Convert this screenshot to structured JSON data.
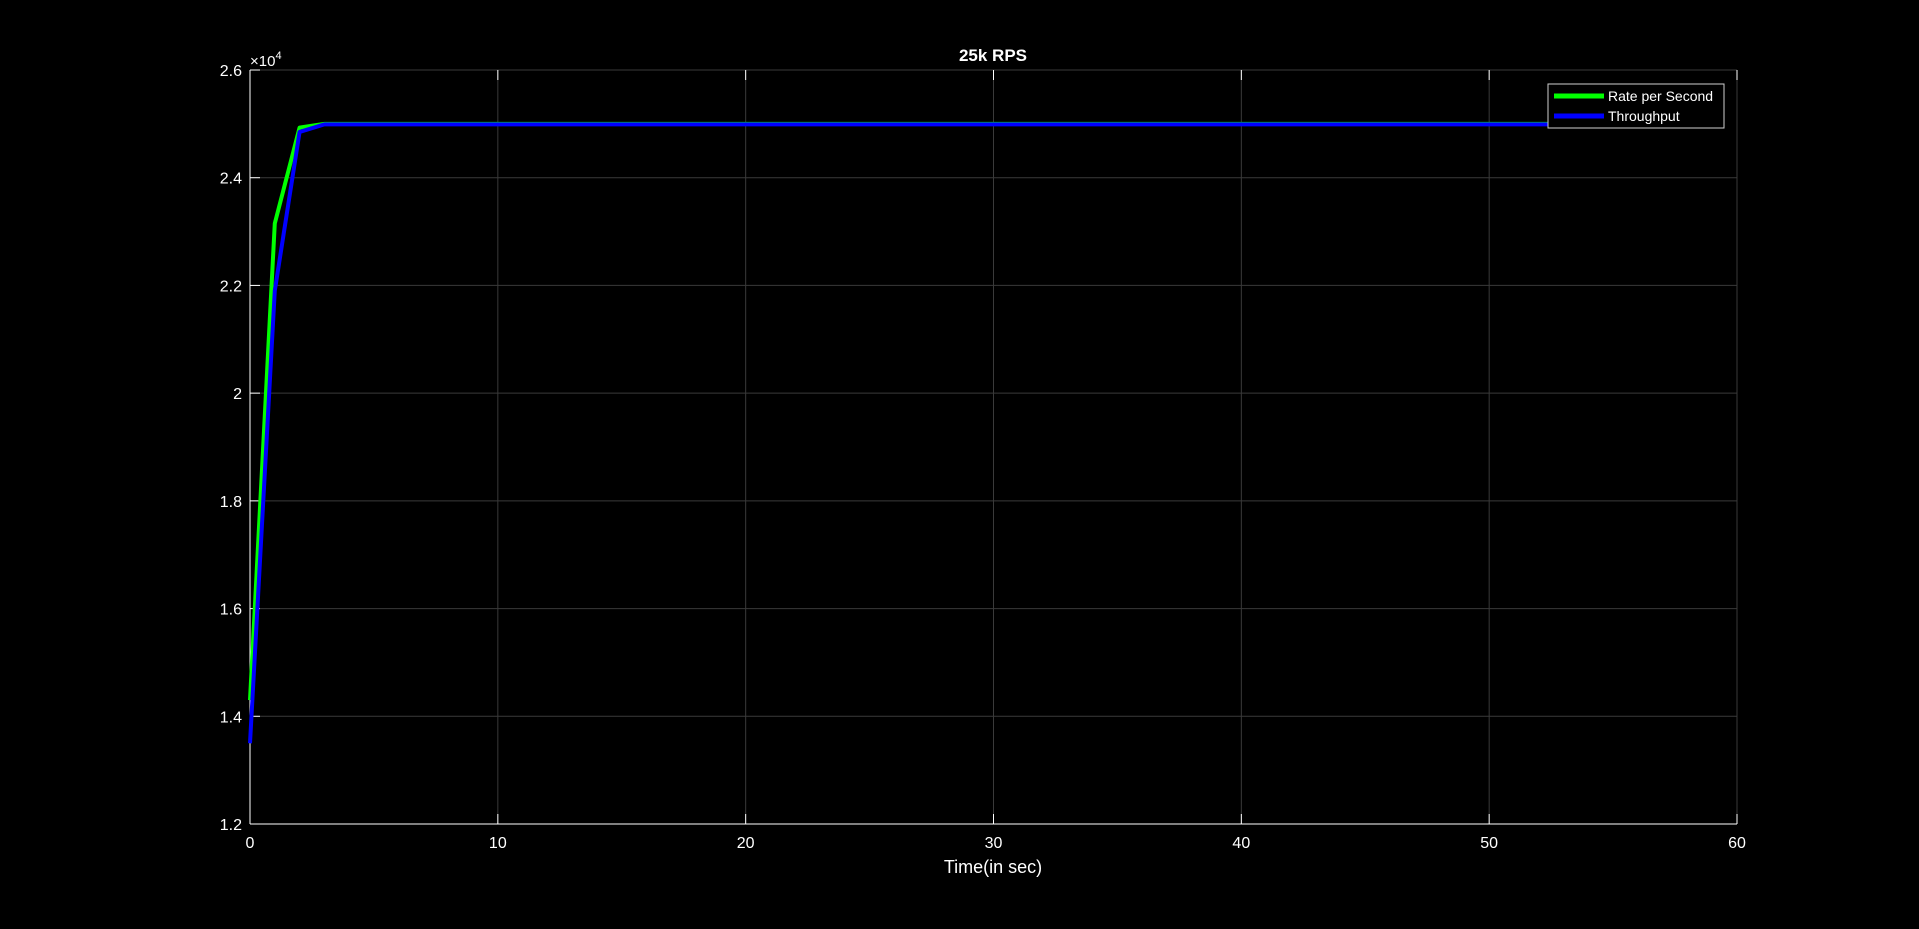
{
  "chart_data": {
    "type": "line",
    "title": "25k RPS",
    "xlabel": "Time(in sec)",
    "ylabel": "",
    "y_exponent_label": "×10",
    "y_exponent_power": "4",
    "xlim": [
      0,
      60
    ],
    "ylim": [
      12000,
      26000
    ],
    "x_ticks": [
      0,
      10,
      20,
      30,
      40,
      50,
      60
    ],
    "x_tick_labels": [
      "0",
      "10",
      "20",
      "30",
      "40",
      "50",
      "60"
    ],
    "y_ticks": [
      12000,
      14000,
      16000,
      18000,
      20000,
      22000,
      24000,
      26000
    ],
    "y_tick_labels": [
      "1.2",
      "1.4",
      "1.6",
      "1.8",
      "2",
      "2.2",
      "2.4",
      "2.6"
    ],
    "grid": true,
    "legend_position": "top-right",
    "series": [
      {
        "name": "Rate per Second",
        "color": "#00ff00",
        "x": [
          0,
          1,
          2,
          3,
          4,
          5,
          10,
          15,
          20,
          25,
          30,
          35,
          40,
          45,
          50,
          55
        ],
        "values": [
          14300,
          23150,
          24930,
          25000,
          25000,
          25000,
          25000,
          25000,
          25000,
          25000,
          25000,
          25000,
          25000,
          25000,
          25000,
          25000
        ]
      },
      {
        "name": "Throughput",
        "color": "#0000ff",
        "x": [
          0,
          1,
          2,
          3,
          4,
          5,
          10,
          15,
          20,
          25,
          30,
          35,
          40,
          45,
          50,
          55
        ],
        "values": [
          13500,
          21900,
          24850,
          24990,
          24990,
          24990,
          24990,
          24990,
          24990,
          24990,
          24990,
          24990,
          24990,
          24990,
          24990,
          24990
        ]
      }
    ]
  }
}
